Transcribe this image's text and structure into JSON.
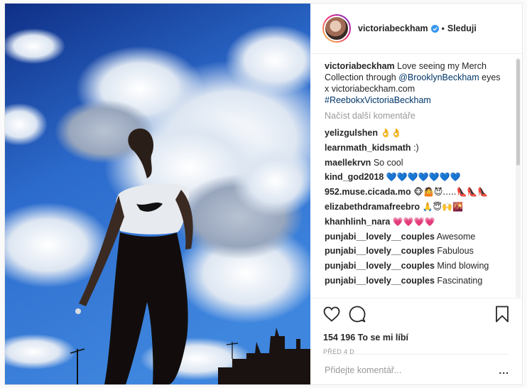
{
  "header": {
    "username": "victoriabeckham",
    "separator": "•",
    "follow_label": "Sleduji"
  },
  "caption": {
    "username": "victoriabeckham",
    "text_1": " Love seeing my Merch Collection through ",
    "mention": "@BrooklynBeckham",
    "text_2": " eyes x victoriabeckham.com ",
    "hashtag": "#ReebokxVictoriaBeckham"
  },
  "load_more_label": "Načíst další komentáře",
  "comments": [
    {
      "user": "yelizgulshen",
      "text": "👌👌"
    },
    {
      "user": "learnmath_kidsmath",
      "text": ":)"
    },
    {
      "user": "maellekrvn",
      "text": "So cool"
    },
    {
      "user": "kind_god2018",
      "text": "💙💙💙💙💙💙💙"
    },
    {
      "user": "952.muse.cicada.mo",
      "text": "🐵🤷😈.....👠👠👠"
    },
    {
      "user": "elizabethdramafreebro",
      "text": "🙏😇🙌🌇"
    },
    {
      "user": "khanhlinh_nara",
      "text": "💗💗💗💗"
    },
    {
      "user": "punjabi__lovely__couples",
      "text": "Awesome"
    },
    {
      "user": "punjabi__lovely__couples",
      "text": "Fabulous"
    },
    {
      "user": "punjabi__lovely__couples",
      "text": "Mind blowing"
    },
    {
      "user": "punjabi__lovely__couples",
      "text": "Fascinating"
    }
  ],
  "stats": {
    "likes_count": "154 196",
    "likes_label": " To se mi líbí",
    "timestamp": "PŘED 4 D"
  },
  "composer": {
    "placeholder": "Přidejte komentář...",
    "more_label": "..."
  },
  "icons": {
    "verified": "verified-badge-icon",
    "like": "heart-icon",
    "comment": "comment-bubble-icon",
    "save": "bookmark-icon"
  },
  "colors": {
    "verified": "#3897f0",
    "link": "#003569",
    "muted": "#999999"
  }
}
